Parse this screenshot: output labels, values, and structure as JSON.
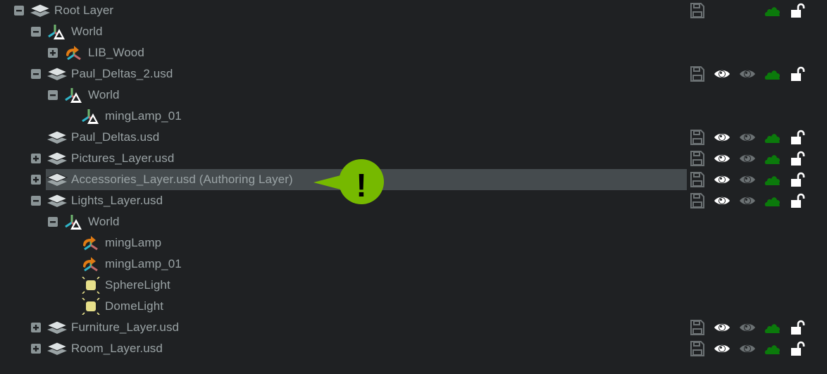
{
  "tree": {
    "rows": [
      {
        "label": "Root Layer",
        "level": 0,
        "expander": "minus",
        "icon": "layers-icon",
        "right": [
          "save",
          "cloud",
          "lock"
        ]
      },
      {
        "label": "World",
        "level": 1,
        "expander": "minus",
        "icon": "xform-icon"
      },
      {
        "label": "LIB_Wood",
        "level": 2,
        "expander": "plus",
        "icon": "reference-icon"
      },
      {
        "label": "Paul_Deltas_2.usd",
        "level": 1,
        "expander": "minus",
        "icon": "layers-icon",
        "right": [
          "save",
          "eye",
          "eye-dim",
          "cloud",
          "lock"
        ]
      },
      {
        "label": "World",
        "level": 2,
        "expander": "minus",
        "icon": "xform-icon"
      },
      {
        "label": "mingLamp_01",
        "level": 3,
        "expander": "none",
        "icon": "xform-icon"
      },
      {
        "label": "Paul_Deltas.usd",
        "level": 1,
        "expander": "none",
        "icon": "layers-icon",
        "right": [
          "save",
          "eye",
          "eye-dim",
          "cloud",
          "lock"
        ]
      },
      {
        "label": "Pictures_Layer.usd",
        "level": 1,
        "expander": "plus",
        "icon": "layers-icon",
        "right": [
          "save",
          "eye",
          "eye-dim",
          "cloud",
          "lock"
        ]
      },
      {
        "label": "Accessories_Layer.usd (Authoring Layer)",
        "level": 1,
        "expander": "plus",
        "icon": "layers-icon",
        "selected": true,
        "right": [
          "save",
          "eye",
          "eye-dim",
          "cloud",
          "lock"
        ]
      },
      {
        "label": "Lights_Layer.usd",
        "level": 1,
        "expander": "minus",
        "icon": "layers-icon",
        "right": [
          "save",
          "eye",
          "eye-dim",
          "cloud",
          "lock"
        ]
      },
      {
        "label": "World",
        "level": 2,
        "expander": "minus",
        "icon": "xform-icon"
      },
      {
        "label": "mingLamp",
        "level": 3,
        "expander": "none",
        "icon": "reference-icon"
      },
      {
        "label": "mingLamp_01",
        "level": 3,
        "expander": "none",
        "icon": "reference-icon"
      },
      {
        "label": "SphereLight",
        "level": 3,
        "expander": "none",
        "icon": "light-icon"
      },
      {
        "label": "DomeLight",
        "level": 3,
        "expander": "none",
        "icon": "light-icon"
      },
      {
        "label": "Furniture_Layer.usd",
        "level": 1,
        "expander": "plus",
        "icon": "layers-icon",
        "right": [
          "save",
          "eye",
          "eye-dim",
          "cloud",
          "lock"
        ]
      },
      {
        "label": "Room_Layer.usd",
        "level": 1,
        "expander": "plus",
        "icon": "layers-icon",
        "right": [
          "save",
          "eye",
          "eye-dim",
          "cloud",
          "lock"
        ]
      }
    ]
  },
  "callout": {
    "text": "!",
    "icon": "warning-callout-icon",
    "color": "#76b900"
  },
  "colors": {
    "background": "#1f2123",
    "selected_row": "#454b4e",
    "text": "#9aa3a5",
    "cloud": "#0b7a0b",
    "accent": "#76b900"
  }
}
